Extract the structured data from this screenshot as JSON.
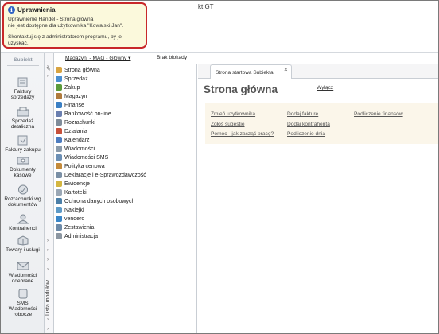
{
  "window": {
    "title_fragment": "kt GT"
  },
  "balloon": {
    "title": "Uprawnienia",
    "line1": "Uprawnienie Handel - Strona główna",
    "line2": "nie jest dostępne dla użytkownika \"Kowalski Jan\".",
    "line3": "Skontaktuj się z administratorem programu, by je uzyskać."
  },
  "sidebar": {
    "logo": "Subiekt",
    "items": [
      {
        "label1": "Faktury",
        "label2": "sprzedaży",
        "icon": "invoice-icon"
      },
      {
        "label1": "Sprzedaż",
        "label2": "detaliczna",
        "icon": "retail-icon"
      },
      {
        "label1": "Faktury zakupu",
        "label2": "",
        "icon": "purchase-invoice-icon"
      },
      {
        "label1": "Dokumenty",
        "label2": "kasowe",
        "icon": "cash-document-icon"
      },
      {
        "label1": "Rozrachunki wg",
        "label2": "dokumentów",
        "icon": "settlements-icon"
      },
      {
        "label1": "Kontrahenci",
        "label2": "",
        "icon": "contractors-icon"
      },
      {
        "label1": "Towary i usługi",
        "label2": "",
        "icon": "goods-icon"
      },
      {
        "label1": "Wiadomości",
        "label2": "odebrane",
        "icon": "messages-icon"
      },
      {
        "label1": "SMS",
        "label2": "Wiadomości",
        "label3": "robocze",
        "icon": "sms-icon"
      }
    ],
    "module_list_label": "Lista modułów"
  },
  "toolbar": {
    "magazyn": "Magazyn: - MAG - Główny ▾",
    "blokady": "Brak blokady"
  },
  "tree": {
    "items": [
      {
        "label": "Strona główna",
        "color": "#d9a441"
      },
      {
        "label": "Sprzedaż",
        "color": "#4a8fd1"
      },
      {
        "label": "Zakup",
        "color": "#5b9b3a"
      },
      {
        "label": "Magazyn",
        "color": "#b07a3c"
      },
      {
        "label": "Finanse",
        "color": "#3a7fc4"
      },
      {
        "label": "Bankowość on-line",
        "color": "#6a7fb0"
      },
      {
        "label": "Rozrachunki",
        "color": "#7f8c9a"
      },
      {
        "label": "Działania",
        "color": "#c7503a"
      },
      {
        "label": "Kalendarz",
        "color": "#4d7cc0"
      },
      {
        "label": "Wiadomości",
        "color": "#8a9aaa"
      },
      {
        "label": "Wiadomości SMS",
        "color": "#6b8fb5"
      },
      {
        "label": "Polityka cenowa",
        "color": "#c48a3a"
      },
      {
        "label": "Deklaracje i e-Sprawozdawczość",
        "color": "#7a8fa5"
      },
      {
        "label": "Ewidencje",
        "color": "#d4b640"
      },
      {
        "label": "Kartoteki",
        "color": "#9aa7b5"
      },
      {
        "label": "Ochrona danych osobowych",
        "color": "#4b7fa8"
      },
      {
        "label": "Naklejki",
        "color": "#5d9ac7"
      },
      {
        "label": "vendero",
        "color": "#3a86c8"
      },
      {
        "label": "Zestawienia",
        "color": "#6d8aa8"
      },
      {
        "label": "Administracja",
        "color": "#8c96a1"
      }
    ]
  },
  "tab": {
    "label": "Strona startowa Subiekta",
    "close": "×"
  },
  "main": {
    "title": "Strona główna",
    "wylacz": "Wyłącz",
    "links": {
      "zmien_uzytkownika": "Zmień użytkownika",
      "zglos_sugestie": "Zgłoś sugestię",
      "pomoc": "Pomoc - jak zacząć pracę?",
      "dodaj_fakture": "Dodaj fakturę",
      "dodaj_kontrahenta": "Dodaj kontrahenta",
      "podliczenie_dnia": "Podliczenie dnia",
      "podliczenie_finansow": "Podliczenie finansów"
    }
  }
}
